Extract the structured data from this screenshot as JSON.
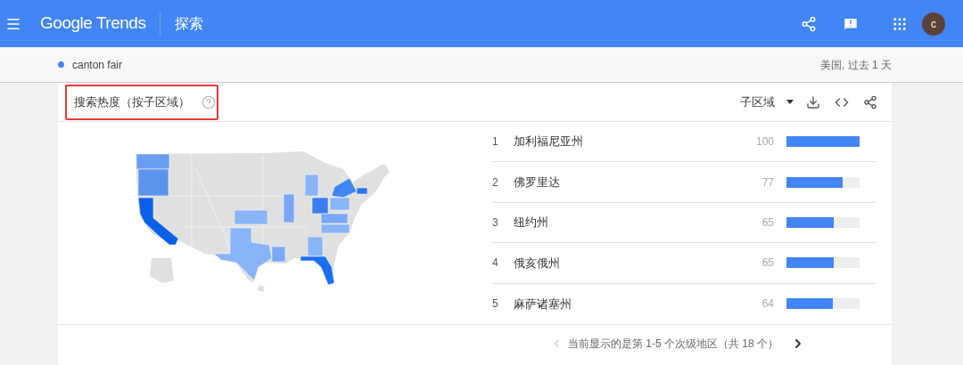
{
  "header": {
    "logo": "Google Trends",
    "section": "探索",
    "avatar": "c"
  },
  "search_term": {
    "label": "canton fair"
  },
  "filter": "美国, 过去 1 天",
  "card": {
    "title": "搜索热度（按子区域）",
    "dropdown": "子区域",
    "rows": [
      {
        "rank": "1",
        "name": "加利福尼亚州",
        "value": "100",
        "level": 1
      },
      {
        "rank": "2",
        "name": "佛罗里达",
        "value": "77",
        "level": 0.77
      },
      {
        "rank": "3",
        "name": "纽约州",
        "value": "65",
        "level": 0.65
      },
      {
        "rank": "4",
        "name": "俄亥俄州",
        "value": "65",
        "level": 0.65
      },
      {
        "rank": "5",
        "name": "麻萨诸塞州",
        "value": "64",
        "level": 0.64
      }
    ],
    "pagination": {
      "text": "当前显示的是第 1-5 个次级地区（共 18 个）",
      "prev": {
        "disabled": true
      },
      "next": {
        "disabled": false
      }
    }
  }
}
